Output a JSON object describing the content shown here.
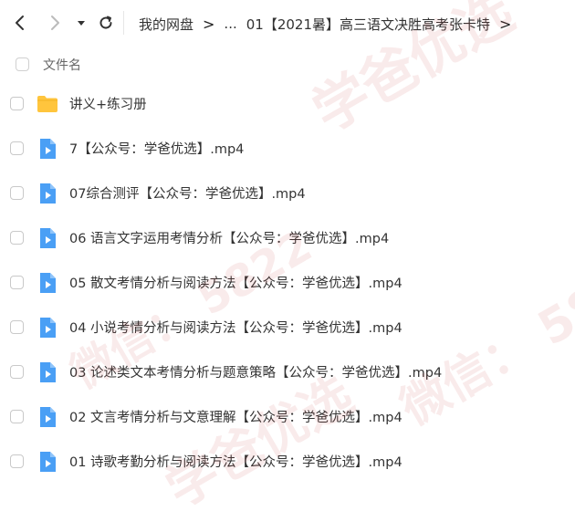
{
  "toolbar": {
    "back_icon": "chevron-left-icon",
    "forward_icon": "chevron-right-icon",
    "dropdown_icon": "caret-down-icon",
    "refresh_icon": "refresh-icon"
  },
  "breadcrumb": {
    "root": "我的网盘",
    "ellipsis": "...",
    "current": "01【2021暑】高三语文决胜高考张卡特",
    "separator": ">"
  },
  "header": {
    "column_label": "文件名"
  },
  "files": [
    {
      "name": "讲义+练习册",
      "type": "folder"
    },
    {
      "name": "7【公众号：学爸优选】.mp4",
      "type": "video"
    },
    {
      "name": "07综合测评【公众号：学爸优选】.mp4",
      "type": "video"
    },
    {
      "name": "06 语言文字运用考情分析【公众号：学爸优选】.mp4",
      "type": "video"
    },
    {
      "name": "05 散文考情分析与阅读方法【公众号：学爸优选】.mp4",
      "type": "video"
    },
    {
      "name": "04 小说考情分析与阅读方法【公众号：学爸优选】.mp4",
      "type": "video"
    },
    {
      "name": "03 论述类文本考情分析与题意策略【公众号：学爸优选】.mp4",
      "type": "video"
    },
    {
      "name": "02 文言考情分析与文意理解【公众号：学爸优选】.mp4",
      "type": "video"
    },
    {
      "name": "01  诗歌考勤分析与阅读方法【公众号：学爸优选】.mp4",
      "type": "video"
    }
  ],
  "watermark": {
    "line1": "学爸优选",
    "line2": "微信：",
    "line3": "5822"
  },
  "colors": {
    "folder": "#FFC53D",
    "video": "#4A9FF5",
    "watermark": "#C83C3C"
  }
}
